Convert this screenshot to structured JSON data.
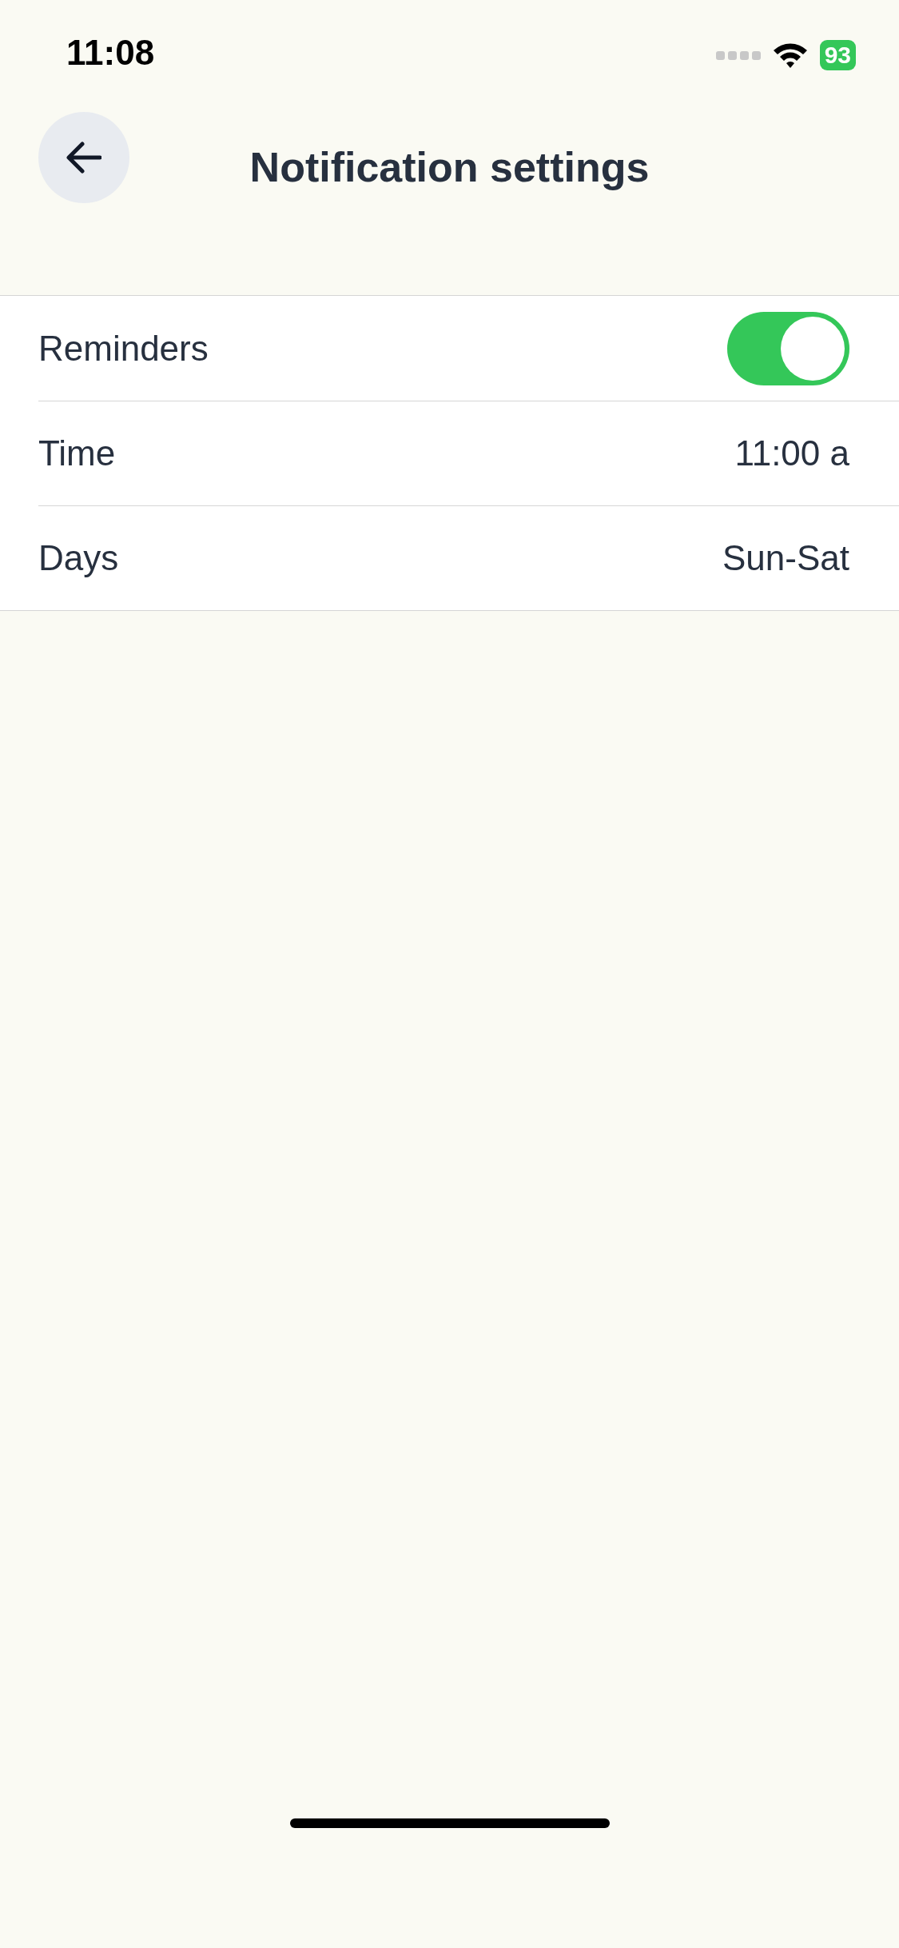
{
  "status_bar": {
    "time": "11:08",
    "battery": "93"
  },
  "header": {
    "title": "Notification settings"
  },
  "settings": [
    {
      "kind": "toggle",
      "label": "Reminders",
      "on": true
    },
    {
      "kind": "value",
      "label": "Time",
      "value": "11:00 a"
    },
    {
      "kind": "value",
      "label": "Days",
      "value": "Sun-Sat"
    }
  ]
}
